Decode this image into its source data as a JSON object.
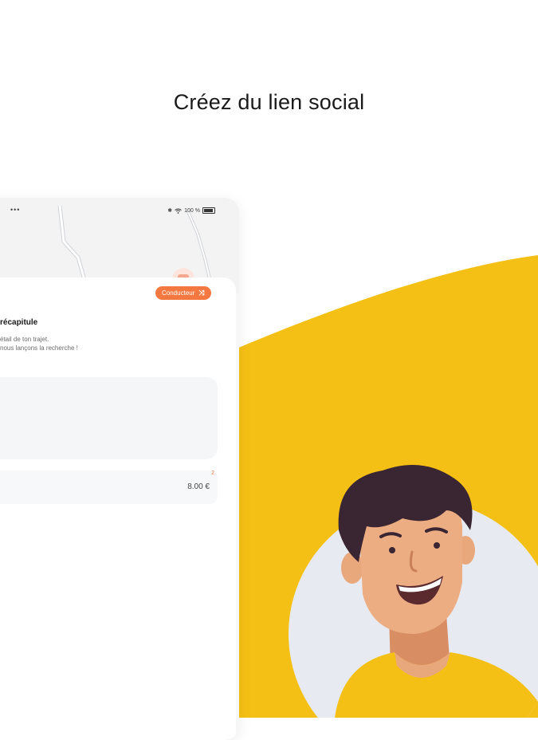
{
  "headline": "Créez du lien social",
  "status_bar": {
    "dots": "•••",
    "battery_text": "100 %"
  },
  "sheet": {
    "role_badge": "Conducteur",
    "title": "récapitule",
    "subtitle_line1": "étail de ton trajet.",
    "subtitle_line2": "nous lançons la recherche !",
    "price": "8.00 €",
    "price_mark": "2"
  },
  "colors": {
    "accent_yellow": "#F5C015",
    "accent_orange": "#F4783F",
    "avatar_circle": "#E7EBF1"
  },
  "icons": [
    "wifi-icon",
    "bluetooth-icon",
    "battery-icon",
    "swap-icon",
    "map-pin-icon"
  ]
}
